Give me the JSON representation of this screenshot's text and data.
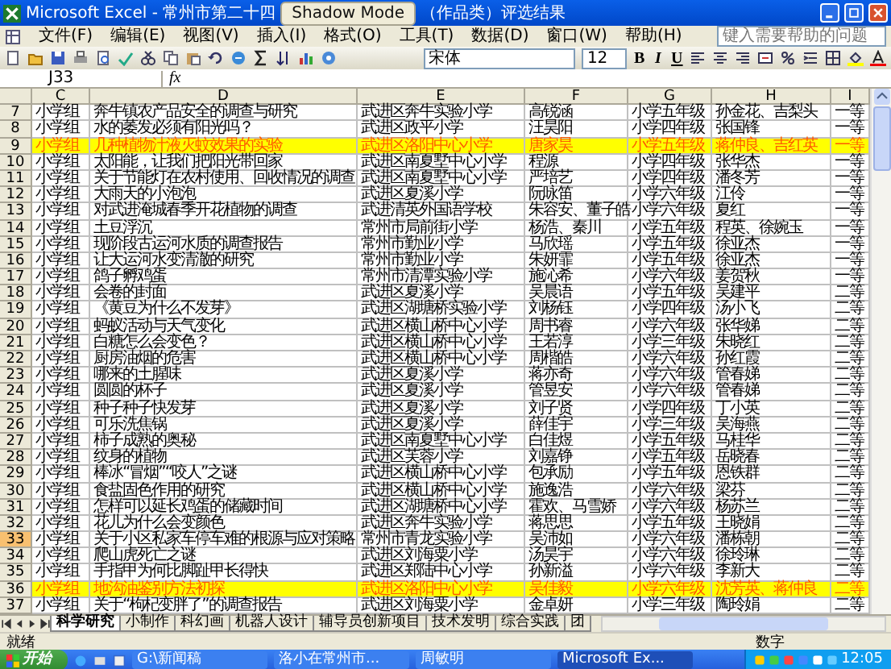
{
  "window": {
    "title_left": "Microsoft Excel - 常州市第二十四",
    "title_right": "（作品类）评选结果"
  },
  "overlay": {
    "text": "Shadow Mode"
  },
  "menu": [
    "文件(F)",
    "编辑(E)",
    "视图(V)",
    "插入(I)",
    "格式(O)",
    "工具(T)",
    "数据(D)",
    "窗口(W)",
    "帮助(H)"
  ],
  "help_placeholder": "键入需要帮助的问题",
  "toolbar": {
    "font": "宋体",
    "size": "12",
    "format_buttons": [
      "B",
      "I",
      "U"
    ]
  },
  "formula_bar": {
    "name_box": "J33",
    "function_label": "fx"
  },
  "columns": [
    "C",
    "D",
    "E",
    "F",
    "G",
    "H",
    "I"
  ],
  "rows": [
    {
      "number": "7",
      "cells": [
        "小学组",
        "奔牛镇农产品安全的调查与研究",
        "武进区奔牛实验小学",
        "高锐涵",
        "小学五年级",
        "孙金花、吉梨头",
        "一等"
      ],
      "highlighted": false,
      "selected": false
    },
    {
      "number": "8",
      "cells": [
        "小学组",
        "水的萎发必须有阳光吗？",
        "武进区政平小学",
        "汪昊阳",
        "小学四年级",
        "张国锋",
        "一等"
      ],
      "highlighted": false,
      "selected": false
    },
    {
      "number": "9",
      "cells": [
        "小学组",
        "几种植物汁液灭蚊效果的实验",
        "武进区洛阳中心小学",
        "唐家昊",
        "小学五年级",
        "蒋仲良、吉红英",
        "一等"
      ],
      "highlighted": true,
      "selected": false
    },
    {
      "number": "10",
      "cells": [
        "小学组",
        "太阳能，让我们把阳光带回家",
        "武进区南夏墅中心小学",
        "程源",
        "小学四年级",
        "张华杰",
        "一等"
      ],
      "highlighted": false,
      "selected": false
    },
    {
      "number": "11",
      "cells": [
        "小学组",
        "关于节能灯在农村使用、回收情况的调查",
        "武进区南夏墅中心小学",
        "严培艺",
        "小学四年级",
        "潘冬芳",
        "一等"
      ],
      "highlighted": false,
      "selected": false
    },
    {
      "number": "12",
      "cells": [
        "小学组",
        "大雨天的小泡泡",
        "武进区夏溪小学",
        "阮咏笛",
        "小学六年级",
        "江伶",
        "一等"
      ],
      "highlighted": false,
      "selected": false
    },
    {
      "number": "13",
      "cells": [
        "小学组",
        "对武进淹城春季开花植物的调查",
        "武进清英外国语学校",
        "朱容安、董子皓",
        "小学六年级",
        "夏红",
        "一等"
      ],
      "highlighted": false,
      "selected": false
    },
    {
      "number": "14",
      "cells": [
        "小学组",
        "土豆浮沉",
        "常州市局前街小学",
        "杨浩、秦川",
        "小学五年级",
        "程英、徐婉玉",
        "一等"
      ],
      "highlighted": false,
      "selected": false
    },
    {
      "number": "15",
      "cells": [
        "小学组",
        "现阶段古运河水质的调查报告",
        "常州市勤业小学",
        "马欣瑶",
        "小学五年级",
        "徐亚杰",
        "一等"
      ],
      "highlighted": false,
      "selected": false
    },
    {
      "number": "16",
      "cells": [
        "小学组",
        "让大运河水变清澈的研究",
        "常州市勤业小学",
        "朱妍霏",
        "小学五年级",
        "徐亚杰",
        "一等"
      ],
      "highlighted": false,
      "selected": false
    },
    {
      "number": "17",
      "cells": [
        "小学组",
        "鸽子孵鸡蛋",
        "常州市清潭实验小学",
        "施沁希",
        "小学六年级",
        "姜贺秋",
        "一等"
      ],
      "highlighted": false,
      "selected": false
    },
    {
      "number": "18",
      "cells": [
        "小学组",
        "会卷的封面",
        "武进区夏溪小学",
        "吴晨语",
        "小学五年级",
        "吴建平",
        "二等"
      ],
      "highlighted": false,
      "selected": false
    },
    {
      "number": "19",
      "cells": [
        "小学组",
        "《黄豆为什么不发芽》",
        "武进区湖塘桥实验小学",
        "刘杨钰",
        "小学四年级",
        "汤小飞",
        "二等"
      ],
      "highlighted": false,
      "selected": false
    },
    {
      "number": "20",
      "cells": [
        "小学组",
        "蚂蚁活动与天气变化",
        "武进区横山桥中心小学",
        "周书睿",
        "小学六年级",
        "张华娣",
        "二等"
      ],
      "highlighted": false,
      "selected": false
    },
    {
      "number": "21",
      "cells": [
        "小学组",
        "白糖怎么会变色？",
        "武进区横山桥中心小学",
        "王若淳",
        "小学三年级",
        "朱晓红",
        "二等"
      ],
      "highlighted": false,
      "selected": false
    },
    {
      "number": "22",
      "cells": [
        "小学组",
        "厨房油烟的危害",
        "武进区横山桥中心小学",
        "周楷皓",
        "小学六年级",
        "孙红霞",
        "二等"
      ],
      "highlighted": false,
      "selected": false
    },
    {
      "number": "23",
      "cells": [
        "小学组",
        "哪来的土腥味",
        "武进区夏溪小学",
        "蒋亦奇",
        "小学六年级",
        "管春娣",
        "二等"
      ],
      "highlighted": false,
      "selected": false
    },
    {
      "number": "24",
      "cells": [
        "小学组",
        "圆圆的杯子",
        "武进区夏溪小学",
        "管昱安",
        "小学六年级",
        "管春娣",
        "二等"
      ],
      "highlighted": false,
      "selected": false
    },
    {
      "number": "25",
      "cells": [
        "小学组",
        "种子种子快发芽",
        "武进区夏溪小学",
        "刘子贤",
        "小学四年级",
        "丁小英",
        "二等"
      ],
      "highlighted": false,
      "selected": false
    },
    {
      "number": "26",
      "cells": [
        "小学组",
        "可乐洗焦锅",
        "武进区夏溪小学",
        "薛佳宇",
        "小学三年级",
        "吴海燕",
        "二等"
      ],
      "highlighted": false,
      "selected": false
    },
    {
      "number": "27",
      "cells": [
        "小学组",
        "柿子成熟的奥秘",
        "武进区南夏墅中心小学",
        "白佳煜",
        "小学五年级",
        "马桂华",
        "二等"
      ],
      "highlighted": false,
      "selected": false
    },
    {
      "number": "28",
      "cells": [
        "小学组",
        "纹身的植物",
        "武进区芙蓉小学",
        "刘嘉铮",
        "小学五年级",
        "岳晓春",
        "二等"
      ],
      "highlighted": false,
      "selected": false
    },
    {
      "number": "29",
      "cells": [
        "小学组",
        "棒冰“冒烟”“咬人”之谜",
        "武进区横山桥中心小学",
        "包承励",
        "小学五年级",
        "恩铁群",
        "二等"
      ],
      "highlighted": false,
      "selected": false
    },
    {
      "number": "30",
      "cells": [
        "小学组",
        "食盐固色作用的研究",
        "武进区横山桥中心小学",
        "施逸浩",
        "小学六年级",
        "梁芬",
        "二等"
      ],
      "highlighted": false,
      "selected": false
    },
    {
      "number": "31",
      "cells": [
        "小学组",
        "怎样可以延长鸡蛋的储藏时间",
        "武进区湖塘桥中心小学",
        "霍欢、马雪娇",
        "小学六年级",
        "杨苏兰",
        "二等"
      ],
      "highlighted": false,
      "selected": false
    },
    {
      "number": "32",
      "cells": [
        "小学组",
        "花儿为什么会变颜色",
        "武进区奔牛实验小学",
        "蒋思思",
        "小学五年级",
        "王晓娟",
        "二等"
      ],
      "highlighted": false,
      "selected": false
    },
    {
      "number": "33",
      "cells": [
        "小学组",
        "关于小区私家车停车难的根源与应对策略",
        "常州市青龙实验小学",
        "吴沛如",
        "小学六年级",
        "潘栋朝",
        "二等"
      ],
      "highlighted": false,
      "selected": true
    },
    {
      "number": "34",
      "cells": [
        "小学组",
        "爬山虎死亡之谜",
        "武进区刘海粟小学",
        "汤昊宇",
        "小学六年级",
        "徐玲琳",
        "二等"
      ],
      "highlighted": false,
      "selected": false
    },
    {
      "number": "35",
      "cells": [
        "小学组",
        "手指甲为何比脚趾甲长得快",
        "武进区郑陆中心小学",
        "孙新溢",
        "小学六年级",
        "李新大",
        "二等"
      ],
      "highlighted": false,
      "selected": false
    },
    {
      "number": "36",
      "cells": [
        "小学组",
        "地沟油鉴别方法初探",
        "武进区洛阳中心小学",
        "吴佳毅",
        "小学六年级",
        "沈芳英、蒋仲良",
        "二等"
      ],
      "highlighted": true,
      "selected": false
    },
    {
      "number": "37",
      "cells": [
        "小学组",
        "关于“枸杞变胖了”的调查报告",
        "武进区刘海粟小学",
        "金卓妍",
        "小学三年级",
        "陶玲娟",
        "二等"
      ],
      "highlighted": false,
      "selected": false
    }
  ],
  "sheet_tabs": [
    {
      "label": "科学研究",
      "selected": true
    },
    {
      "label": "小制作",
      "selected": false
    },
    {
      "label": "科幻画",
      "selected": false
    },
    {
      "label": "机器人设计",
      "selected": false
    },
    {
      "label": "辅导员创新项目",
      "selected": false
    },
    {
      "label": "技术发明",
      "selected": false
    },
    {
      "label": "综合实践",
      "selected": false
    },
    {
      "label": "团",
      "selected": false
    }
  ],
  "status": {
    "left": "就绪",
    "right": "数字"
  },
  "taskbar": {
    "start": "开始",
    "tasks": [
      {
        "label": "G:\\新闻稿",
        "selected": false
      },
      {
        "label": "洛小在常州市...",
        "selected": false
      },
      {
        "label": "周敏明",
        "selected": false
      },
      {
        "label": "Microsoft Ex...",
        "selected": true
      }
    ],
    "clock": "12:05"
  }
}
